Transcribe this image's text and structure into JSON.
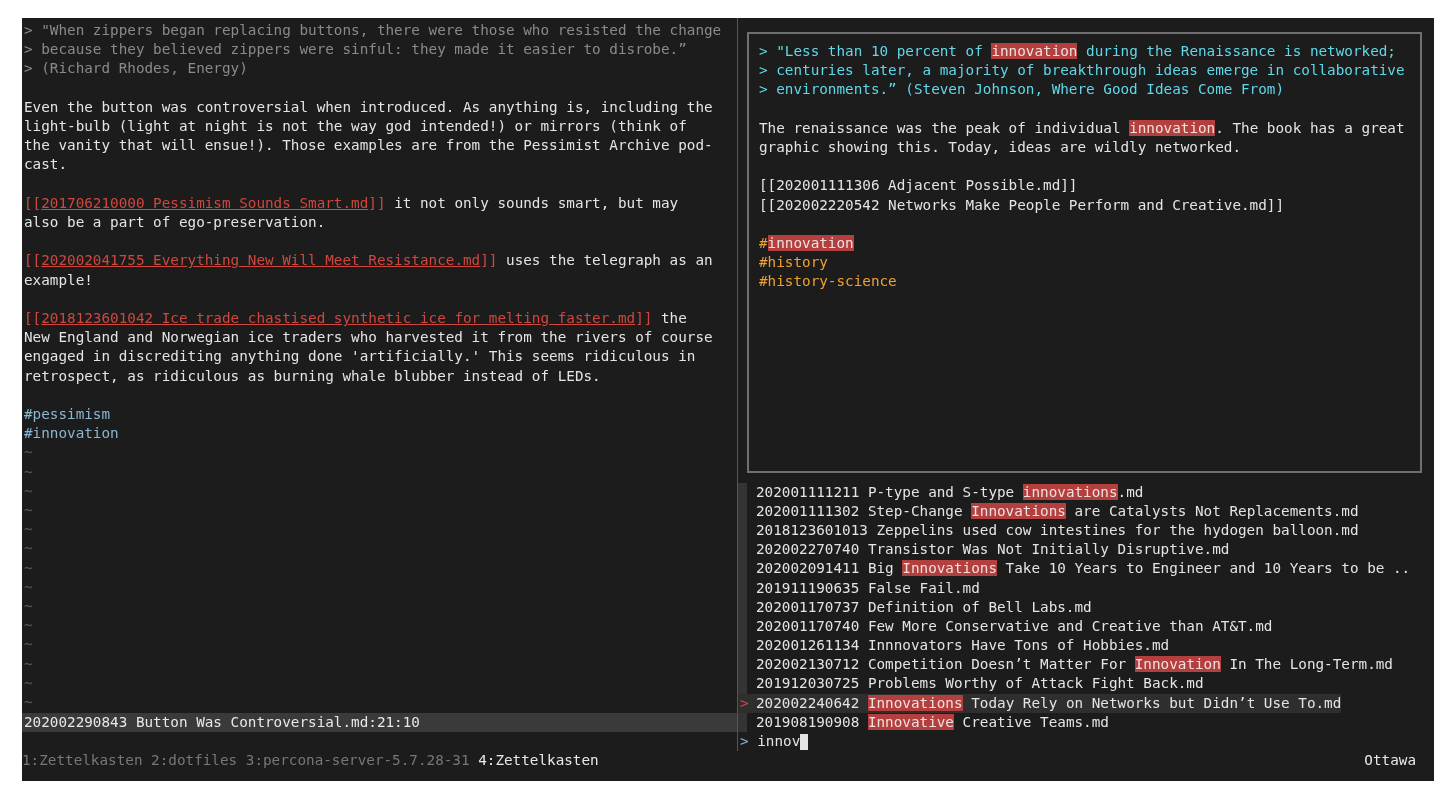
{
  "editor": {
    "quote": [
      "> \"When zippers began replacing buttons, there were those who resisted the change",
      "> because they believed zippers were sinful: they made it easier to disrobe.”",
      "> (Richard Rhodes, Energy)"
    ],
    "paragraphs": [
      {
        "segments": [
          {
            "kind": "text",
            "text": "Even the button was controversial when introduced. As anything is, including the light-bulb (light at night is not the way god intended!) or mirrors (think of the vanity that will ensue!). Those examples are from the Pessimist Archive pod-cast."
          }
        ]
      },
      {
        "segments": [
          {
            "kind": "link",
            "open": "[[",
            "target": "201706210000 Pessimism Sounds Smart.md",
            "close": "]]"
          },
          {
            "kind": "text",
            "text": " it not only sounds smart, but may also be a part of ego-preservation."
          }
        ]
      },
      {
        "segments": [
          {
            "kind": "link",
            "open": "[[",
            "target": "202002041755 Everything New Will Meet Resistance.md",
            "close": "]]"
          },
          {
            "kind": "text",
            "text": " uses the telegraph as an example!"
          }
        ]
      },
      {
        "segments": [
          {
            "kind": "link",
            "open": "[[",
            "target": "2018123601042 Ice trade chastised synthetic ice for melting faster.md",
            "close": "]]"
          },
          {
            "kind": "text",
            "text": " the New England and Norwegian ice traders who harvested it from the rivers of course engaged in discrediting anything done 'artificially.' This seems ridiculous in retrospect, as ridiculous as burning whale blubber instead of LEDs."
          }
        ]
      }
    ],
    "tags": [
      "#pessimism",
      "#innovation"
    ],
    "empty_lines": [
      "~",
      "~",
      "~",
      "~",
      "~",
      "~",
      "~",
      "~",
      "~",
      "~",
      "~",
      "~",
      "~",
      "~"
    ],
    "status_line": "202002290843 Button Was Controversial.md:21:10"
  },
  "preview": {
    "quote": [
      [
        {
          "text": "> \"Less than 10 percent of ",
          "match": false
        },
        {
          "text": "innovation",
          "match": true
        },
        {
          "text": " during the Renaissance is networked;",
          "match": false
        }
      ],
      [
        {
          "text": "> centuries later, a majority of breakthrough ideas emerge in collaborative",
          "match": false
        }
      ],
      [
        {
          "text": "> environments.” (Steven Johnson, Where Good Ideas Come From)",
          "match": false
        }
      ]
    ],
    "paragraph": [
      {
        "text": "The renaissance was the peak of individual ",
        "match": false
      },
      {
        "text": "innovation",
        "match": true
      },
      {
        "text": ". The book has a great graphic showing this. Today, ideas are wildly networked.",
        "match": false
      }
    ],
    "links": [
      "[[202001111306 Adjacent Possible.md]]",
      "[[202002220542 Networks Make People Perform and Creative.md]]"
    ],
    "tags": [
      [
        {
          "text": "#",
          "match": false
        },
        {
          "text": "innovation",
          "match": true
        }
      ],
      [
        {
          "text": "#history",
          "match": false
        }
      ],
      [
        {
          "text": "#history-science",
          "match": false
        }
      ]
    ]
  },
  "results": {
    "pointer": ">",
    "items": [
      {
        "selected": false,
        "segments": [
          {
            "text": "202001111211 P-type and S-type ",
            "match": false
          },
          {
            "text": "innovations",
            "match": true
          },
          {
            "text": ".md",
            "match": false
          }
        ]
      },
      {
        "selected": false,
        "segments": [
          {
            "text": "202001111302 Step-Change ",
            "match": false
          },
          {
            "text": "Innovations",
            "match": true
          },
          {
            "text": " are Catalysts Not Replacements.md",
            "match": false
          }
        ]
      },
      {
        "selected": false,
        "segments": [
          {
            "text": "2018123601013 Zeppelins used cow intestines for the hydogen balloon.md",
            "match": false
          }
        ]
      },
      {
        "selected": false,
        "segments": [
          {
            "text": "202002270740 Transistor Was Not Initially Disruptive.md",
            "match": false
          }
        ]
      },
      {
        "selected": false,
        "segments": [
          {
            "text": "202002091411 Big ",
            "match": false
          },
          {
            "text": "Innovations",
            "match": true
          },
          {
            "text": " Take 10 Years to Engineer and 10 Years to be ..",
            "match": false
          }
        ]
      },
      {
        "selected": false,
        "segments": [
          {
            "text": "201911190635 False Fail.md",
            "match": false
          }
        ]
      },
      {
        "selected": false,
        "segments": [
          {
            "text": "202001170737 Definition of Bell Labs.md",
            "match": false
          }
        ]
      },
      {
        "selected": false,
        "segments": [
          {
            "text": "202001170740 Few More Conservative and Creative than AT&T.md",
            "match": false
          }
        ]
      },
      {
        "selected": false,
        "segments": [
          {
            "text": "202001261134 Innnovators Have Tons of Hobbies.md",
            "match": false
          }
        ]
      },
      {
        "selected": false,
        "segments": [
          {
            "text": "202002130712 Competition Doesn’t Matter For ",
            "match": false
          },
          {
            "text": "Innovation",
            "match": true
          },
          {
            "text": " In The Long-Term.md",
            "match": false
          }
        ]
      },
      {
        "selected": false,
        "segments": [
          {
            "text": "201912030725 Problems Worthy of Attack Fight Back.md",
            "match": false
          }
        ]
      },
      {
        "selected": true,
        "segments": [
          {
            "text": "202002240642 ",
            "match": false
          },
          {
            "text": "Innovations",
            "match": true
          },
          {
            "text": " Today Rely on Networks but Didn’t Use To.md",
            "match": false
          }
        ]
      },
      {
        "selected": false,
        "segments": [
          {
            "text": "201908190908 ",
            "match": false
          },
          {
            "text": "Innovative",
            "match": true
          },
          {
            "text": " Creative Teams.md",
            "match": false
          }
        ]
      }
    ],
    "prompt": ">",
    "query": "innov"
  },
  "tmux": {
    "windows": [
      {
        "label": "1:Zettelkasten",
        "selected": false
      },
      {
        "label": "2:dotfiles",
        "selected": false
      },
      {
        "label": "3:percona-server-5.7.28-31",
        "selected": false
      },
      {
        "label": "4:Zettelkasten",
        "selected": true
      }
    ],
    "status_right": "Ottawa"
  }
}
